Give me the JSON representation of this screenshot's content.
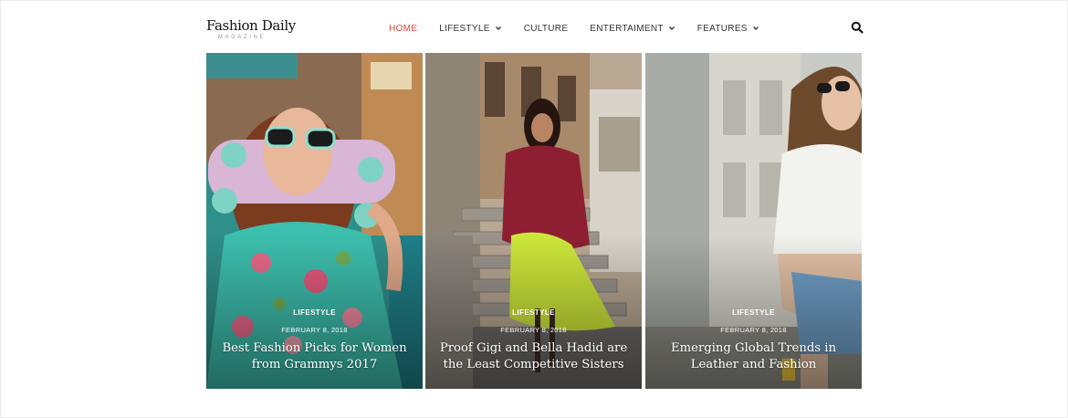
{
  "header": {
    "logo_title": "Fashion Daily",
    "logo_subtitle": "MAGAZINE"
  },
  "nav": {
    "items": [
      {
        "label": "HOME",
        "active": true,
        "dropdown": false
      },
      {
        "label": "LIFESTYLE",
        "active": false,
        "dropdown": true
      },
      {
        "label": "CULTURE",
        "active": false,
        "dropdown": false
      },
      {
        "label": "ENTERTAIMENT",
        "active": false,
        "dropdown": true
      },
      {
        "label": "FEATURES",
        "active": false,
        "dropdown": true
      }
    ],
    "active_color": "#e0473c",
    "search_icon": "search-icon"
  },
  "posts": [
    {
      "category": "LIFESTYLE",
      "date": "FEBRUARY 8, 2018",
      "title": "Best Fashion Picks for Women from Grammys 2017"
    },
    {
      "category": "LIFESTYLE",
      "date": "FEBRUARY 8, 2018",
      "title": "Proof Gigi and Bella Hadid are the Least Competitive Sisters"
    },
    {
      "category": "LIFESTYLE",
      "date": "FEBRUARY 8, 2018",
      "title": "Emerging Global Trends in Leather and Fashion"
    }
  ]
}
